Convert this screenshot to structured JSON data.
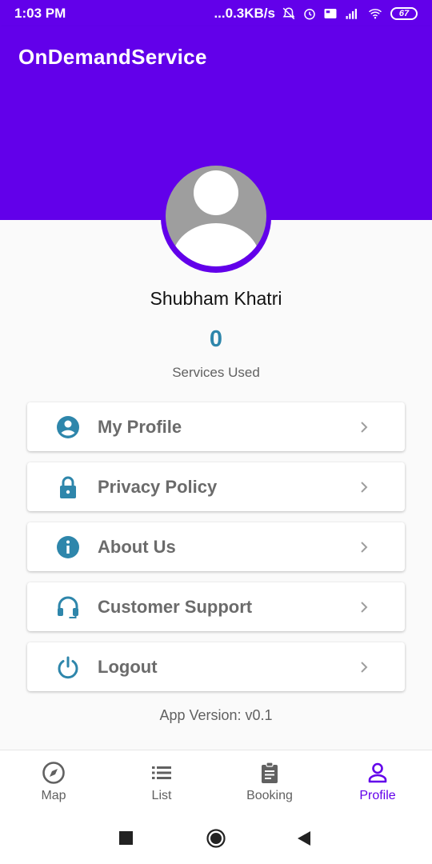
{
  "status_bar": {
    "time": "1:03 PM",
    "network_speed": "...0.3KB/s",
    "battery": "67",
    "icons": [
      "mute-icon",
      "alarm-icon",
      "volte-icon",
      "signal-icon",
      "wifi-icon",
      "battery-icon"
    ]
  },
  "app_bar": {
    "title": "OnDemandService"
  },
  "profile": {
    "name": "Shubham Khatri",
    "services_count": "0",
    "services_label": "Services Used"
  },
  "menu": {
    "items": [
      {
        "label": "My Profile",
        "icon": "account-circle-icon"
      },
      {
        "label": "Privacy Policy",
        "icon": "lock-icon"
      },
      {
        "label": "About Us",
        "icon": "info-icon"
      },
      {
        "label": "Customer Support",
        "icon": "headset-icon"
      },
      {
        "label": "Logout",
        "icon": "power-icon"
      }
    ]
  },
  "app_version": "App Version: v0.1",
  "bottom_nav": {
    "items": [
      {
        "label": "Map",
        "icon": "compass-icon"
      },
      {
        "label": "List",
        "icon": "list-icon"
      },
      {
        "label": "Booking",
        "icon": "clipboard-icon"
      },
      {
        "label": "Profile",
        "icon": "person-icon",
        "active": true
      }
    ]
  },
  "colors": {
    "primary": "#6200ea",
    "accent_blue": "#2e86ab",
    "text_gray": "#6b6b6b"
  }
}
